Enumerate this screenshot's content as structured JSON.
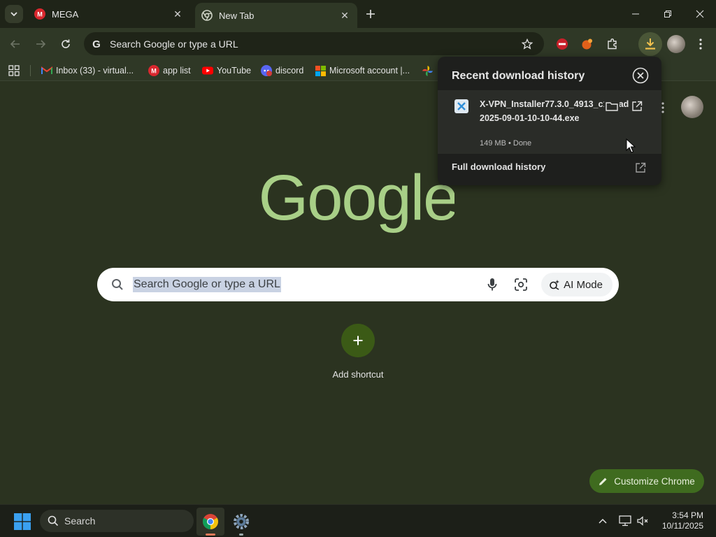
{
  "tabs": [
    {
      "title": "MEGA",
      "favicon": "mega-icon",
      "active": false
    },
    {
      "title": "New Tab",
      "favicon": "chrome-icon",
      "active": true
    }
  ],
  "toolbar": {
    "omnibox_text": "Search Google or type a URL"
  },
  "bookmarks": [
    {
      "label": "Inbox (33) - virtual...",
      "icon": "gmail-icon"
    },
    {
      "label": "app list",
      "icon": "mega-icon"
    },
    {
      "label": "YouTube",
      "icon": "youtube-icon"
    },
    {
      "label": "discord",
      "icon": "discord-icon"
    },
    {
      "label": "Microsoft account |...",
      "icon": "microsoft-icon"
    }
  ],
  "download_bubble": {
    "title": "Recent download history",
    "item": {
      "filename": "X-VPN_Installer77.3.0_4913_c1bbad5b_2025-09-01-10-10-44.exe",
      "meta": "149 MB • Done"
    },
    "full_history_label": "Full download history"
  },
  "page": {
    "search_placeholder": "Search Google or type a URL",
    "ai_mode_label": "AI Mode",
    "add_shortcut_label": "Add shortcut",
    "customize_label": "Customize Chrome"
  },
  "taskbar": {
    "search_label": "Search",
    "time": "3:54 PM",
    "date": "10/11/2025"
  },
  "colors": {
    "page_bg": "#2b3320",
    "logo_green": "#a8cf87",
    "accent_green": "#3f6b1f"
  }
}
